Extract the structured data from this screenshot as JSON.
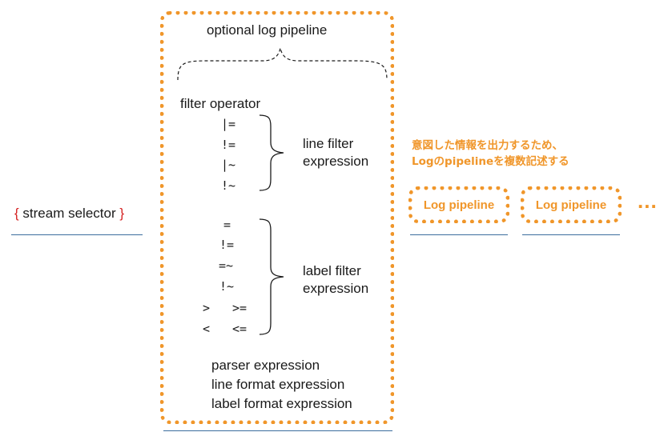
{
  "stream_selector": {
    "open_brace": "{",
    "label": "stream selector",
    "close_brace": "}"
  },
  "pipeline": {
    "title": "optional log pipeline",
    "filter_operator_label": "filter operator",
    "line_filter_ops": [
      "|=",
      "!=",
      "|~",
      "!~"
    ],
    "line_filter_label": [
      "line filter",
      "expression"
    ],
    "label_filter_ops": [
      "=",
      "!=",
      "=~",
      "!~",
      ">",
      ">=",
      "<",
      "<="
    ],
    "label_filter_label": [
      "label filter",
      "expression"
    ],
    "expressions": [
      "parser expression",
      "line format expression",
      "label format expression"
    ]
  },
  "annotation": {
    "line1": "意図した情報を出力するため、",
    "line2": "Logのpipelineを複数記述する"
  },
  "log_pipelines": [
    "Log pipeline",
    "Log pipeline"
  ],
  "ellipsis": "...",
  "colors": {
    "accent": "#f0962a",
    "brace_red": "#d42020",
    "underline": "#3c6e9e"
  }
}
